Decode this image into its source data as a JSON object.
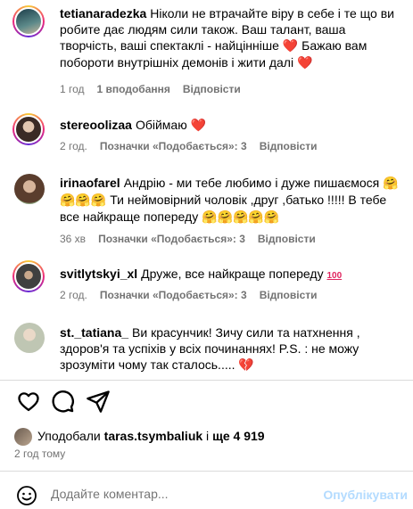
{
  "comments": [
    {
      "user": "tetianaradezka",
      "text": "Ніколи не втрачайте віру в себе і те що ви робите дає людям сили також. Ваш талант, ваша творчість, ваші спектаклі - найцінніше",
      "text2": "Бажаю вам побороти внутрішніх демонів і жити далі",
      "time": "1 год",
      "likes": "1 вподобання",
      "reply": "Відповісти"
    },
    {
      "user": "stereoolizaa",
      "text": "Обіймаю",
      "time": "2 год.",
      "likes": "Позначки «Подобається»: 3",
      "reply": "Відповісти"
    },
    {
      "user": "irinaofarel",
      "text": "Андрію - ми тебе любимо і дуже пишаємося",
      "text2": "Ти неймовірний чоловік ,друг ,батько !!!!! В тебе все найкраще попереду",
      "time": "36 хв",
      "likes": "Позначки «Подобається»: 3",
      "reply": "Відповісти"
    },
    {
      "user": "svitlytskyi_xl",
      "text": "Друже, все найкраще попереду",
      "emoji_text": "100",
      "time": "2 год.",
      "likes": "Позначки «Подобається»: 3",
      "reply": "Відповісти"
    },
    {
      "user": "st._tatiana_",
      "text": "Ви красунчик! Зичу сили та натхнення , здоров'я та успіхів у всіх починаннях! P.S. : не можу зрозуміти чому так сталось....."
    }
  ],
  "likes_row": {
    "prefix": "Уподобали",
    "user": "taras.tsymbaliuk",
    "middle": "і",
    "rest": "ще 4 919"
  },
  "post_time": "2 год тому",
  "add_comment": {
    "placeholder": "Додайте коментар...",
    "post_label": "Опублікувати"
  },
  "colors": {
    "accent_disabled": "#b3dbff",
    "meta": "#737373",
    "heart": "#ed1e5a"
  },
  "icons": [
    "heart-icon",
    "comment-icon",
    "share-icon",
    "emoji-icon"
  ]
}
